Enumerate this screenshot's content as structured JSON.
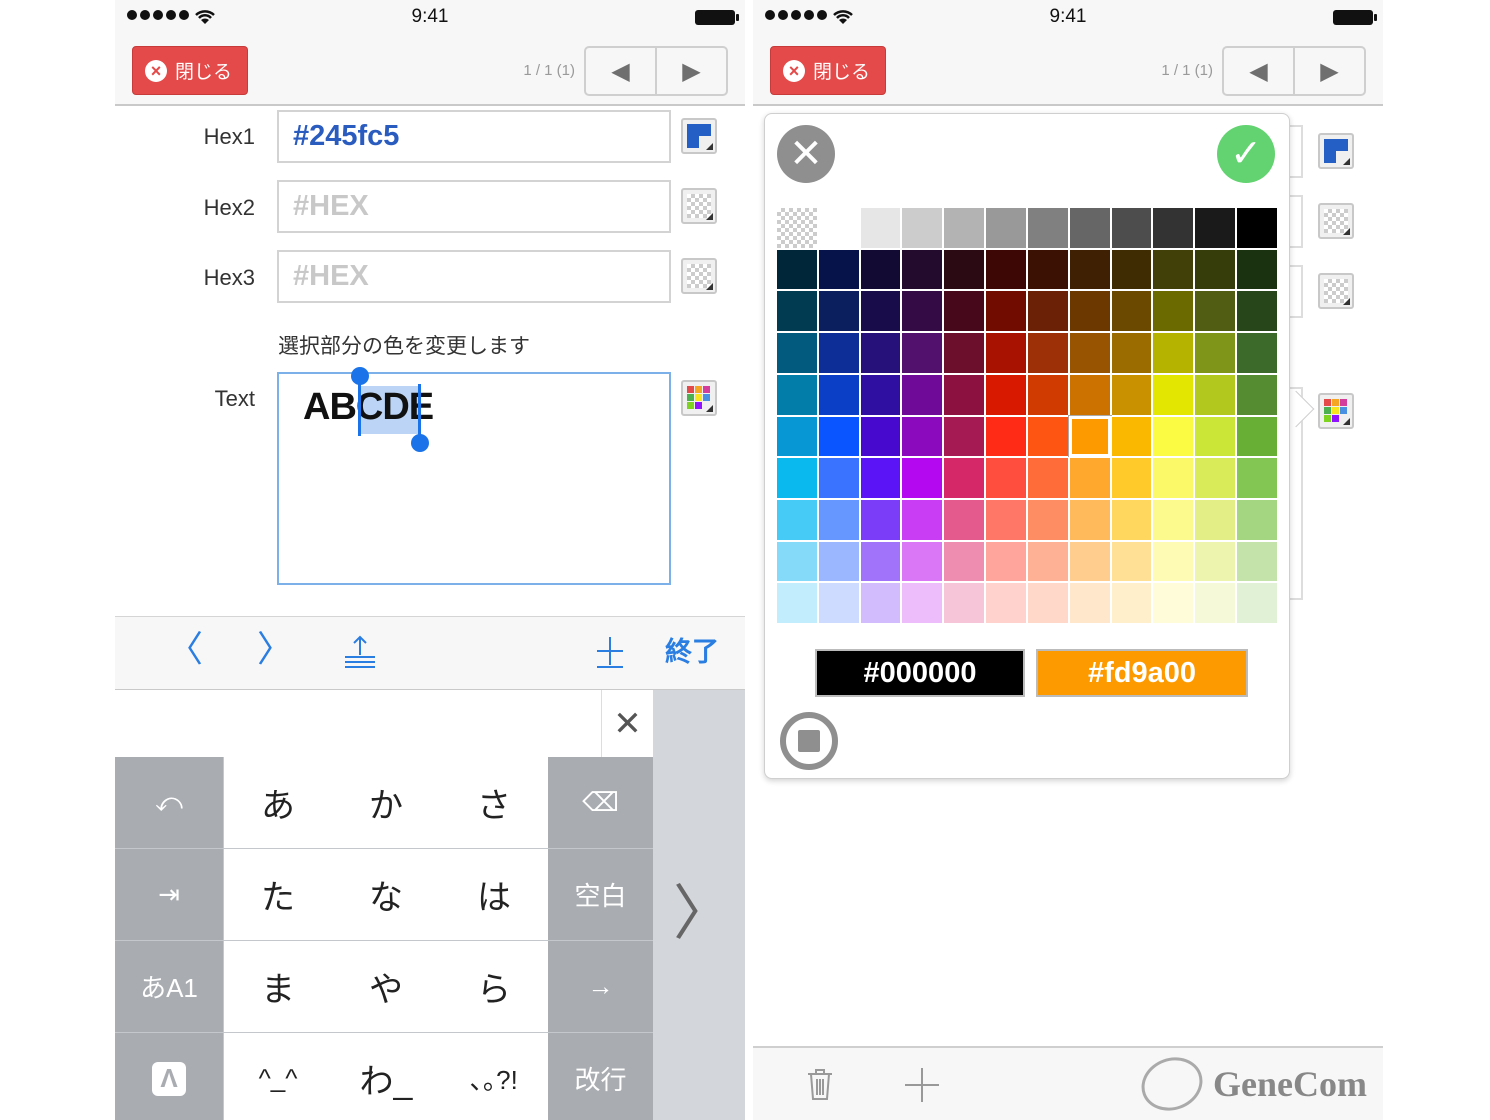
{
  "left_screen": {
    "status": {
      "time": "9:41"
    },
    "header": {
      "close_label": "閉じる",
      "counter": "1 / 1 (1)",
      "prev": "◀",
      "next": "▶"
    },
    "rows": [
      {
        "label": "Hex1",
        "value": "#245fc5",
        "placeholder": "#HEX",
        "swatch": "#245fc5"
      },
      {
        "label": "Hex2",
        "value": "",
        "placeholder": "#HEX"
      },
      {
        "label": "Hex3",
        "value": "",
        "placeholder": "#HEX"
      }
    ],
    "note": "選択部分の色を変更します",
    "text_label": "Text",
    "text_value": "ABCDE",
    "selected_text": "CD",
    "toolbar": {
      "prev": "〈",
      "next": "〉",
      "dismiss": "⩸",
      "add": "＋",
      "done": "終了"
    },
    "candidate_close": "✕",
    "keyboard": {
      "rows": [
        [
          "⤺",
          "あ",
          "か",
          "さ",
          "⌫"
        ],
        [
          "⇥",
          "た",
          "な",
          "は",
          "空白"
        ],
        [
          "あA1",
          "ま",
          "や",
          "ら",
          "→"
        ],
        [
          "Λ",
          "^_^",
          "わ_",
          "､｡?!",
          "改行"
        ]
      ],
      "side_arrow": "〉"
    }
  },
  "right_screen": {
    "status": {
      "time": "9:41"
    },
    "header": {
      "close_label": "閉じる",
      "counter": "1 / 1 (1)",
      "prev": "◀",
      "next": "▶"
    },
    "picker": {
      "cancel_icon": "✕",
      "ok_icon": "✓",
      "palette": [
        [
          "transparent",
          "#ffffff",
          "#e6e6e6",
          "#cccccc",
          "#b3b3b3",
          "#999999",
          "#808080",
          "#666666",
          "#4d4d4d",
          "#333333",
          "#1a1a1a",
          "#000000"
        ],
        [
          "#00263a",
          "#06134b",
          "#130a33",
          "#230b2e",
          "#2c0a14",
          "#3c0705",
          "#3b1104",
          "#402002",
          "#3f2c02",
          "#404008",
          "#363d0a",
          "#1a3210"
        ],
        [
          "#013b51",
          "#0b1e5e",
          "#190c4b",
          "#340b44",
          "#47081c",
          "#710c00",
          "#6b2105",
          "#6d3800",
          "#6b4a00",
          "#6b6a00",
          "#515d12",
          "#27461a"
        ],
        [
          "#025b7e",
          "#0c2e96",
          "#26117a",
          "#51116c",
          "#6b0f2d",
          "#a81200",
          "#9e3007",
          "#985400",
          "#9b6d00",
          "#b5b300",
          "#7f9519",
          "#3c6a2a"
        ],
        [
          "#027da9",
          "#0b3fc5",
          "#2e0fa2",
          "#6f0997",
          "#8c1141",
          "#d91800",
          "#cf3b01",
          "#cc7200",
          "#c99000",
          "#e3e600",
          "#b3c81f",
          "#558c31"
        ],
        [
          "#0797d4",
          "#0a55ff",
          "#4809cf",
          "#8c0abd",
          "#a61a53",
          "#ff2b17",
          "#ff5513",
          "#fd9a00",
          "#fbb800",
          "#fcfb44",
          "#cbe636",
          "#68b035"
        ],
        [
          "#0ab9ee",
          "#3a73ff",
          "#5a14f6",
          "#b308f0",
          "#d52868",
          "#ff4e3d",
          "#ff6c3a",
          "#ffa82d",
          "#ffca2a",
          "#fcf968",
          "#d9eb58",
          "#84c654"
        ],
        [
          "#45cbf6",
          "#6696ff",
          "#7b3df8",
          "#c93df4",
          "#e45a8c",
          "#ff7867",
          "#ff8d64",
          "#ffba5b",
          "#ffd65e",
          "#fdfa8d",
          "#e3ef86",
          "#a4d580"
        ],
        [
          "#85dafa",
          "#9bb7ff",
          "#a173fb",
          "#d977f7",
          "#ee8db0",
          "#ffa59b",
          "#ffb196",
          "#ffce8f",
          "#ffe095",
          "#fefbb4",
          "#ecf4ae",
          "#c3e3aa"
        ],
        [
          "#c2edfd",
          "#ccdbff",
          "#d2bcfd",
          "#edbcfb",
          "#f6c6d8",
          "#ffd2cd",
          "#ffd8ca",
          "#ffe7cb",
          "#fff0cb",
          "#fffdd9",
          "#f5f9d7",
          "#e1f1d5"
        ]
      ],
      "selected": {
        "row": 5,
        "col": 7
      },
      "hex_previous": "#000000",
      "hex_current": "#fd9a00",
      "stop_icon": "■"
    },
    "bottombar": {
      "trash_icon": "🗑",
      "add_icon": "＋",
      "logo_text": "GeneCom"
    }
  }
}
